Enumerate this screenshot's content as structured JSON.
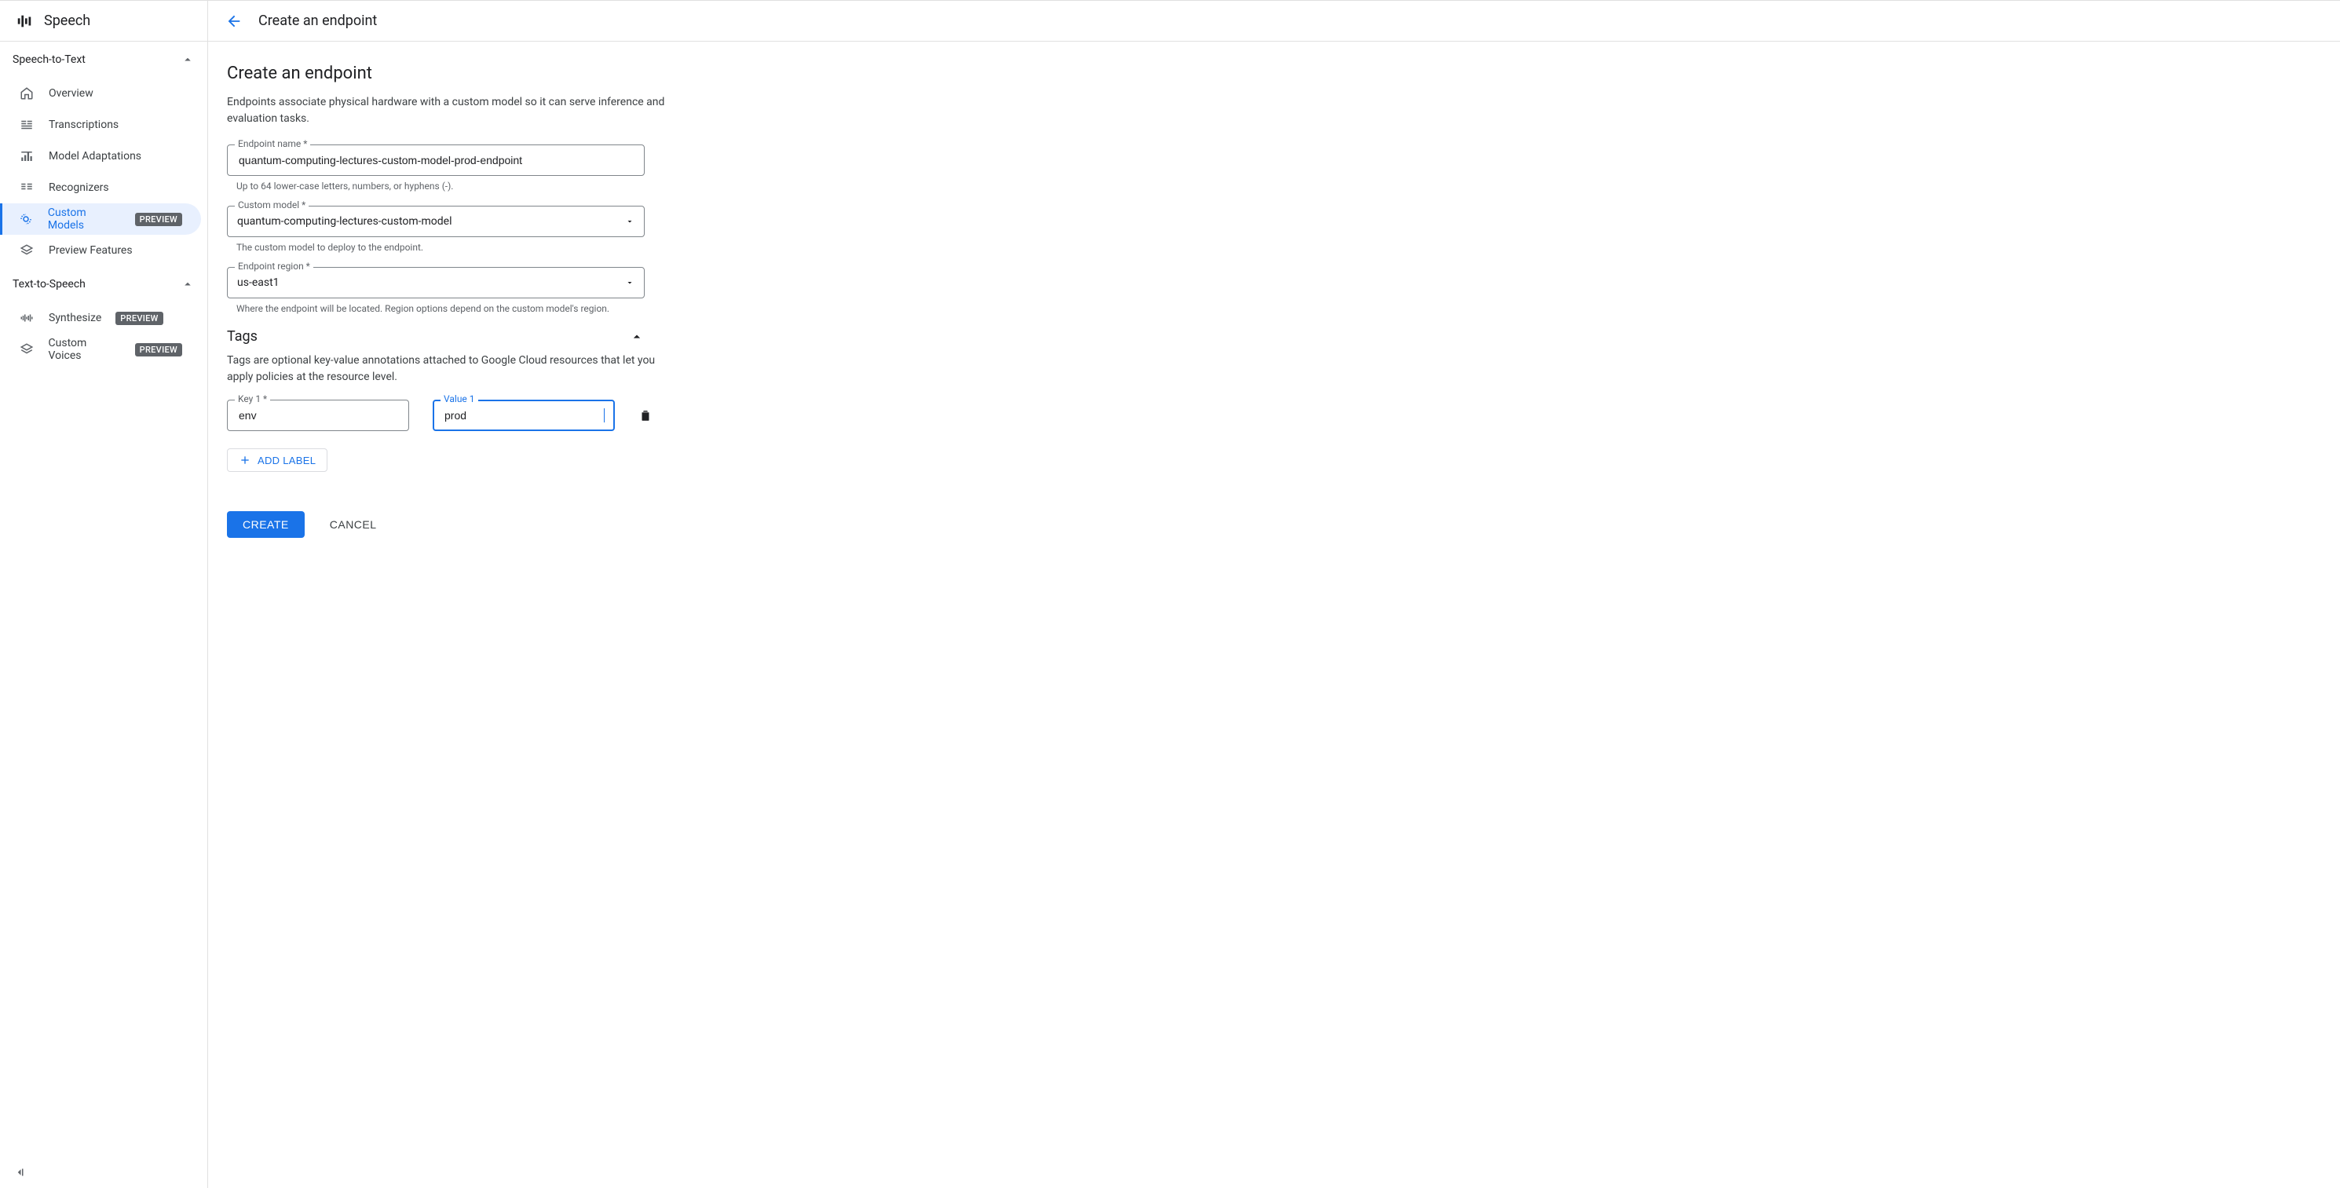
{
  "product": {
    "name": "Speech"
  },
  "sidebar": {
    "sections": [
      {
        "title": "Speech-to-Text",
        "expanded": true,
        "items": [
          {
            "label": "Overview"
          },
          {
            "label": "Transcriptions"
          },
          {
            "label": "Model Adaptations"
          },
          {
            "label": "Recognizers"
          },
          {
            "label": "Custom Models",
            "badge": "PREVIEW",
            "active": true
          },
          {
            "label": "Preview Features"
          }
        ]
      },
      {
        "title": "Text-to-Speech",
        "expanded": true,
        "items": [
          {
            "label": "Synthesize",
            "badge": "PREVIEW"
          },
          {
            "label": "Custom Voices",
            "badge": "PREVIEW"
          }
        ]
      }
    ]
  },
  "header": {
    "title": "Create an endpoint"
  },
  "page": {
    "title": "Create an endpoint",
    "description": "Endpoints associate physical hardware with a custom model so it can serve inference and evaluation tasks.",
    "fields": {
      "name": {
        "label": "Endpoint name *",
        "value": "quantum-computing-lectures-custom-model-prod-endpoint",
        "hint": "Up to 64 lower-case letters, numbers, or hyphens (-)."
      },
      "model": {
        "label": "Custom model *",
        "value": "quantum-computing-lectures-custom-model",
        "hint": "The custom model to deploy to the endpoint."
      },
      "region": {
        "label": "Endpoint region *",
        "value": "us-east1",
        "hint": "Where the endpoint will be located. Region options depend on the custom model's region."
      }
    },
    "tags": {
      "title": "Tags",
      "description": "Tags are optional key-value annotations attached to Google Cloud resources that let you apply policies at the resource level.",
      "rows": [
        {
          "key_label": "Key 1 *",
          "key_value": "env",
          "value_label": "Value 1",
          "value_value": "prod"
        }
      ],
      "add_label_btn": "ADD LABEL"
    },
    "actions": {
      "create": "CREATE",
      "cancel": "CANCEL"
    }
  }
}
